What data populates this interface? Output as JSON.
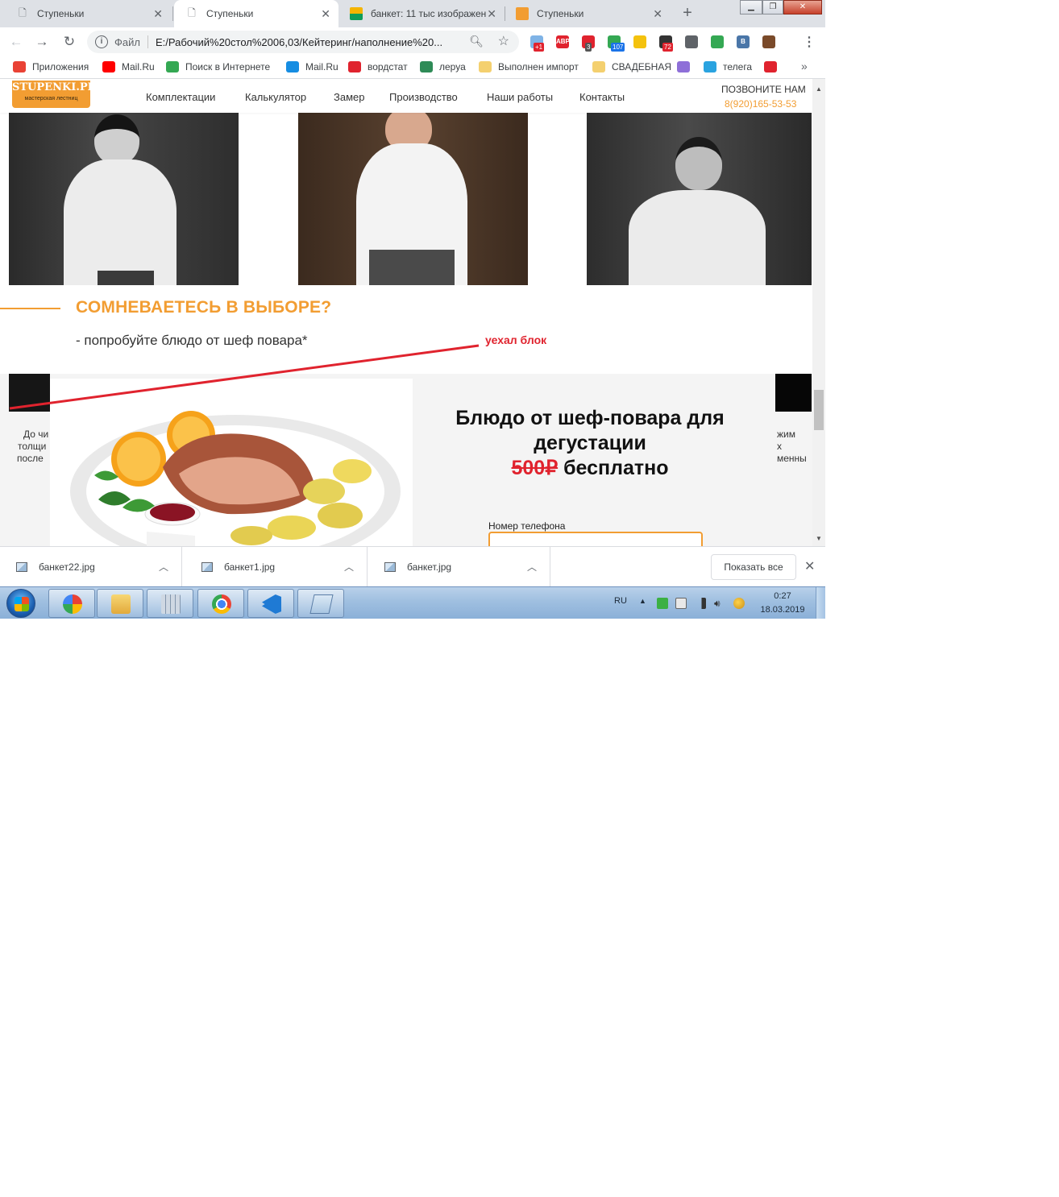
{
  "browser": {
    "tabs": [
      {
        "title": "Ступеньки",
        "icon": "page-icon",
        "active": false
      },
      {
        "title": "Ступеньки",
        "icon": "page-icon",
        "active": true
      },
      {
        "title": "банкет: 11 тыс изображен",
        "icon": "image-icon",
        "active": false
      },
      {
        "title": "Ступеньки",
        "icon": "site-icon",
        "active": false
      }
    ],
    "new_tab_label": "+",
    "window_controls": {
      "minimize": "▁",
      "maximize": "❐",
      "close": "✕"
    },
    "address": {
      "scheme_label": "Файл",
      "url": "E:/Рабочий%20стол%2006,03/Кейтеринг/наполнение%20..."
    },
    "extensions": [
      {
        "name": "weather-ext-icon",
        "badge": "+1",
        "color": "#7fb3e6",
        "badge_color": "#e0232e"
      },
      {
        "name": "adblock-icon",
        "label": "ABP",
        "color": "#e0232e"
      },
      {
        "name": "opera-icon",
        "badge": "3",
        "color": "#e0232e",
        "badge_color": "#555555"
      },
      {
        "name": "vpn-icon",
        "badge": "107",
        "color": "#34a853",
        "badge_color": "#1a73e8"
      },
      {
        "name": "yandex-icon",
        "color": "#f4c20d"
      },
      {
        "name": "chat-icon",
        "badge": "72",
        "color": "#333333",
        "badge_color": "#e0232e"
      },
      {
        "name": "camera-icon",
        "color": "#5f6368"
      },
      {
        "name": "green-ext-icon",
        "color": "#34a853"
      },
      {
        "name": "vk-icon",
        "label": "B",
        "color": "#4a76a8"
      },
      {
        "name": "paint-ext-icon",
        "color": "#7a4a2a"
      }
    ]
  },
  "bookmarks": [
    {
      "label": "Приложения",
      "icon": "apps-grid-icon",
      "color": "#e94235"
    },
    {
      "label": "Mail.Ru",
      "icon": "youtube-icon",
      "color": "#ff0000"
    },
    {
      "label": "Поиск в Интернете",
      "icon": "ke-icon",
      "color": "#34a853"
    },
    {
      "label": "Mail.Ru",
      "icon": "mailru-icon",
      "color": "#168de2"
    },
    {
      "label": "вордстат",
      "icon": "bars-icon",
      "color": "#e0232e"
    },
    {
      "label": "леруа",
      "icon": "leroy-icon",
      "color": "#2e8b57"
    },
    {
      "label": "Выполнен импорт",
      "icon": "folder-icon",
      "color": "#f4d06f"
    },
    {
      "label": "СВАДЕБНАЯ",
      "icon": "folder-icon",
      "color": "#f4d06f"
    },
    {
      "label": "",
      "icon": "dots-icon",
      "color": "#8e6fd8"
    },
    {
      "label": "телега",
      "icon": "telegram-icon",
      "color": "#2aa3e0"
    },
    {
      "label": "",
      "icon": "red-ext-icon",
      "color": "#e0232e"
    }
  ],
  "bookmarks_more": "»",
  "site": {
    "logo_line1": "STUPENKI.PRO",
    "logo_line2": "мастерская лестниц",
    "nav": [
      "Комплектации",
      "Калькулятор",
      "Замер",
      "Производство",
      "Наши работы",
      "Контакты"
    ],
    "call_label": "ПОЗВОНИТЕ НАМ",
    "call_phone": "8(920)165-53-53",
    "section_title": "СОМНЕВАЕТЕСЬ В ВЫБОРЕ?",
    "section_subtitle": "- попробуйте блюдо от шеф повара*",
    "annotation": "уехал блок",
    "snippets_left": [
      "До чи",
      "толщи",
      "после"
    ],
    "snippets_right": [
      "жим",
      "х",
      "менны"
    ],
    "modal": {
      "title": "Блюдо от шеф-повара для дегустации",
      "old_price": "500₽",
      "free_label": "бесплатно",
      "phone_label": "Номер телефона",
      "phone_value": ""
    }
  },
  "downloads": {
    "files": [
      "банкет22.jpg",
      "банкет1.jpg",
      "банкет.jpg"
    ],
    "show_all": "Показать все",
    "close": "✕"
  },
  "taskbar": {
    "apps": [
      "paint-app-icon",
      "explorer-app-icon",
      "calculator-app-icon",
      "chrome-app-icon",
      "vscode-app-icon",
      "notepad-app-icon"
    ],
    "lang": "RU",
    "time": "0:27",
    "date": "18.03.2019"
  },
  "colors": {
    "accent": "#f29d32",
    "annotation_red": "#e0232e"
  }
}
